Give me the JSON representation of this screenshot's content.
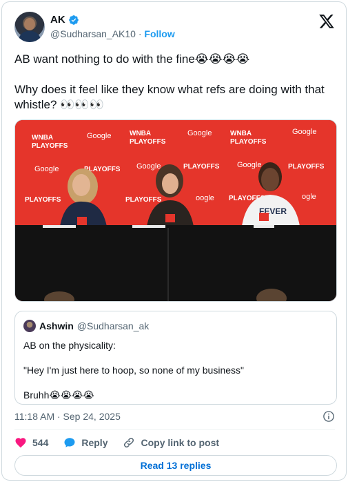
{
  "author": {
    "name": "AK",
    "handle": "@Sudharsan_AK10",
    "separator": "·",
    "follow_label": "Follow"
  },
  "tweet": {
    "line1": "AB want nothing to do with the fine😭😭😭😭",
    "line2": "Why does it feel like they know what refs are doing with that whistle? 👀👀👀"
  },
  "media": {
    "backdrop_color": "#e5352b",
    "sponsor_logos": [
      "WNBA PLAYOFFS",
      "Google"
    ],
    "nameplate_text": "FEVER"
  },
  "quoted_tweet": {
    "name": "Ashwin",
    "handle": "@Sudharsan_ak",
    "line1": "AB on the physicality:",
    "line2": "\"Hey I'm just here to hoop, so none of my business\"",
    "line3": "Bruhh😭😭😭😭"
  },
  "meta": {
    "timestamp": "11:18 AM · Sep 24, 2025"
  },
  "actions": {
    "likes": "544",
    "reply_label": "Reply",
    "copy_link_label": "Copy link to post"
  },
  "read_replies_label": "Read 13 replies",
  "colors": {
    "like": "#f91880",
    "link": "#1d9bf0",
    "reply_button_text": "#006fd6"
  }
}
